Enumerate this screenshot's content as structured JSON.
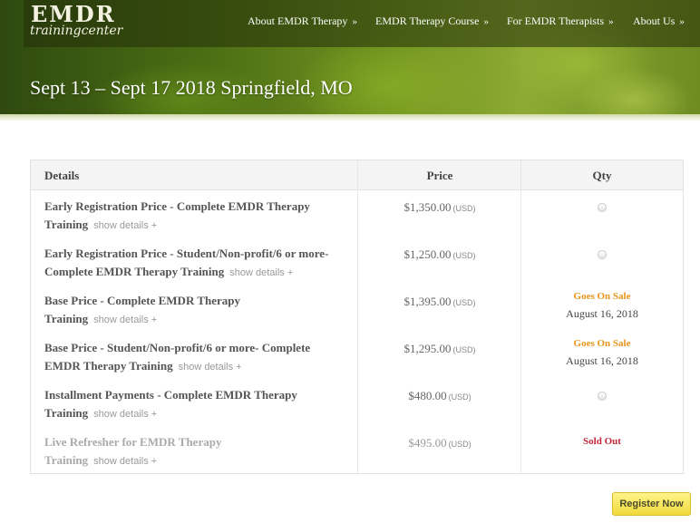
{
  "header": {
    "logo": {
      "main": "EMDR",
      "sub": "trainingcenter"
    },
    "nav": [
      {
        "label": "About EMDR Therapy",
        "chevron": "»"
      },
      {
        "label": "EMDR Therapy Course",
        "chevron": "»"
      },
      {
        "label": "For EMDR Therapists",
        "chevron": "»"
      },
      {
        "label": "About Us",
        "chevron": "»"
      }
    ],
    "title": "Sept 13 – Sept 17 2018 Springfield, MO"
  },
  "ticket_table": {
    "columns": {
      "details": "Details",
      "price": "Price",
      "qty": "Qty"
    },
    "rows": [
      {
        "name": "Early Registration Price - Complete EMDR Therapy Training",
        "show_details": "show details +",
        "price": "$1,350.00",
        "currency": "(USD)",
        "qty_type": "radio"
      },
      {
        "name": "Early Registration Price - Student/Non-profit/6 or more- Complete EMDR Therapy Training",
        "show_details": "show details +",
        "price": "$1,250.00",
        "currency": "(USD)",
        "qty_type": "radio"
      },
      {
        "name": "Base Price - Complete EMDR Therapy Training",
        "show_details": "show details +",
        "price": "$1,395.00",
        "currency": "(USD)",
        "qty_type": "goes_on_sale",
        "status": "Goes On Sale",
        "sale_date": "August 16, 2018"
      },
      {
        "name": "Base Price - Student/Non-profit/6 or more- Complete EMDR Therapy Training",
        "show_details": "show details +",
        "price": "$1,295.00",
        "currency": "(USD)",
        "qty_type": "goes_on_sale",
        "status": "Goes On Sale",
        "sale_date": "August 16, 2018"
      },
      {
        "name": "Installment Payments - Complete EMDR Therapy Training",
        "show_details": "show details +",
        "price": "$480.00",
        "currency": "(USD)",
        "qty_type": "radio"
      },
      {
        "name": "Live Refresher for EMDR Therapy Training",
        "show_details": "show details +",
        "price": "$495.00",
        "currency": "(USD)",
        "qty_type": "sold_out",
        "status": "Sold Out"
      }
    ]
  },
  "register_button": {
    "label": "Register Now"
  },
  "colors": {
    "goes_on_sale": "#e8941a",
    "sold_out": "#c0273a",
    "register_button": "#f1d93a"
  }
}
